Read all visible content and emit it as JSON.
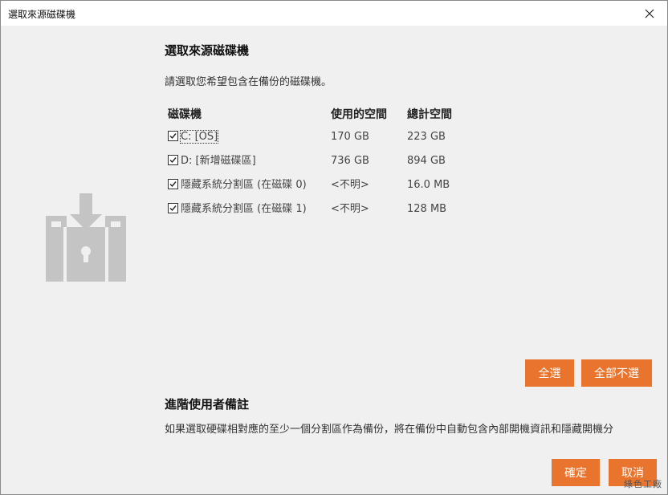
{
  "window": {
    "title": "選取來源磁碟機"
  },
  "main": {
    "heading": "選取來源磁碟機",
    "description": "請選取您希望包含在備份的磁碟機。",
    "columns": {
      "drive": "磁碟機",
      "used": "使用的空間",
      "total": "總計空間"
    },
    "drives": [
      {
        "label": "C: [OS]",
        "used": "170 GB",
        "total": "223 GB",
        "checked": true
      },
      {
        "label": "D: [新增磁碟區]",
        "used": "736 GB",
        "total": "894 GB",
        "checked": true
      },
      {
        "label": "隱藏系統分割區 (在磁碟 0)",
        "used": "<不明>",
        "total": "16.0 MB",
        "checked": true
      },
      {
        "label": "隱藏系統分割區 (在磁碟 1)",
        "used": "<不明>",
        "total": "128 MB",
        "checked": true
      }
    ],
    "select_all_label": "全選",
    "deselect_all_label": "全部不選"
  },
  "advanced": {
    "heading": "進階使用者備註",
    "text": "如果選取硬碟相對應的至少一個分割區作為備份，將在備份中自動包含內部開機資訊和隱藏開機分"
  },
  "footer": {
    "ok_label": "確定",
    "cancel_label": "取消"
  },
  "watermark": "綠色工廠",
  "colors": {
    "accent": "#e8742e",
    "illustration": "#c4c4c4"
  },
  "icons": {
    "close": "close-icon",
    "illustration": "backup-drive-illustration-icon",
    "checkbox": "checkmark-icon"
  }
}
